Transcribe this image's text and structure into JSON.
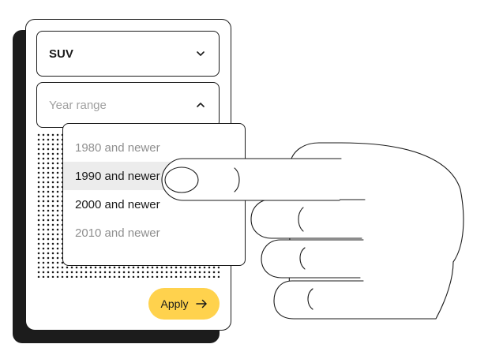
{
  "filter": {
    "vehicle_type": {
      "value": "SUV",
      "icon": "chevron-down-icon"
    },
    "year_range": {
      "placeholder": "Year range",
      "icon": "chevron-up-icon",
      "options": [
        {
          "label": "1980 and newer",
          "state": "muted"
        },
        {
          "label": "1990 and newer",
          "state": "highlighted"
        },
        {
          "label": "2000 and newer",
          "state": "normal"
        },
        {
          "label": "2010 and newer",
          "state": "muted"
        }
      ]
    },
    "apply": {
      "label": "Apply",
      "icon": "arrow-right-icon"
    }
  },
  "colors": {
    "accent": "#ffd24d",
    "ink": "#1a1a1a",
    "shadow": "#1c1c1c",
    "highlight_row": "#ececec",
    "muted_text": "#8f8f8f"
  }
}
